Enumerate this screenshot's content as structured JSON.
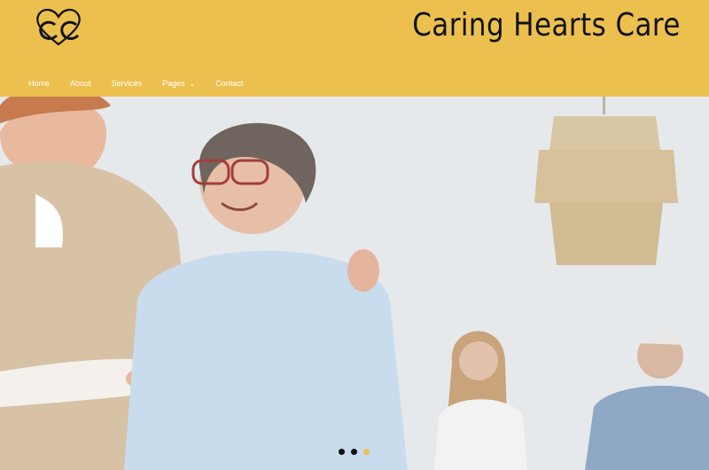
{
  "site": {
    "title": "Caring Hearts Care",
    "brand_color": "#ecc04f"
  },
  "nav": {
    "items": [
      {
        "label": "Home"
      },
      {
        "label": "About"
      },
      {
        "label": "Services"
      },
      {
        "label": "Pages",
        "dropdown_icon": "chevron-down-icon"
      },
      {
        "label": "Contact"
      }
    ]
  },
  "slider": {
    "slide_count": 3,
    "active_index": 2,
    "active_color": "#ecc04f",
    "inactive_color": "#111111"
  }
}
